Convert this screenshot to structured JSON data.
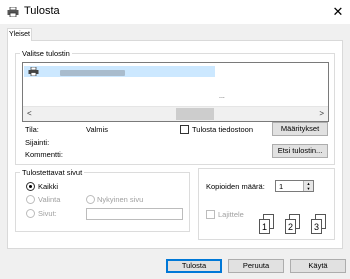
{
  "window": {
    "title": "Tulosta",
    "close_symbol": "✕"
  },
  "tabs": [
    {
      "label": "Yleiset"
    }
  ],
  "select_printer": {
    "legend": "Valitse tulostin",
    "dots": "...",
    "scroll_left": "<",
    "scroll_right": ">"
  },
  "printer_info": {
    "status_label": "Tila:",
    "status_value": "Valmis",
    "location_label": "Sijainti:",
    "comment_label": "Kommentti:",
    "print_to_file_label": "Tulosta tiedostoon",
    "preferences_button": "Määritykset",
    "find_printer_button": "Etsi tulostin..."
  },
  "page_range": {
    "legend": "Tulostettavat sivut",
    "all": "Kaikki",
    "selection": "Valinta",
    "current_page": "Nykyinen sivu",
    "pages": "Sivut:"
  },
  "copies": {
    "label": "Kopioiden määrä:",
    "value": "1",
    "collate_label": "Lajittele",
    "collate_page_numbers": [
      "1",
      "1",
      "2",
      "2",
      "3",
      "3"
    ]
  },
  "buttons": {
    "print": "Tulosta",
    "cancel": "Peruuta",
    "apply": "Käytä"
  },
  "colors": {
    "accent": "#0078d7",
    "selection": "#cce8ff",
    "dialog_bg": "#f0f0f0"
  },
  "icons": [
    "printer-icon",
    "close-icon",
    "scroll-left-icon",
    "scroll-right-icon"
  ]
}
